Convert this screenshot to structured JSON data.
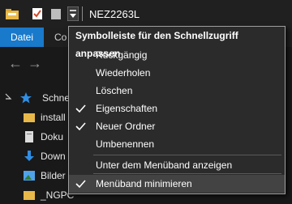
{
  "window": {
    "title": "NEZ2263L"
  },
  "ribbon": {
    "file_tab": "Datei",
    "next_tab_partial": "Co"
  },
  "tree": {
    "quick_access": "Schnell",
    "items": [
      {
        "label": "install",
        "icon": "folder-icon"
      },
      {
        "label": "Doku",
        "icon": "documents-icon"
      },
      {
        "label": "Down",
        "icon": "downloads-icon"
      },
      {
        "label": "Bilder",
        "icon": "pictures-icon"
      },
      {
        "label": "_NGPC",
        "icon": "folder-icon"
      }
    ]
  },
  "menu": {
    "header": "Symbolleiste für den Schnellzugriff anpassen",
    "items": [
      {
        "label": "Rückgängig",
        "checked": false
      },
      {
        "label": "Wiederholen",
        "checked": false
      },
      {
        "label": "Löschen",
        "checked": false
      },
      {
        "label": "Eigenschaften",
        "checked": true
      },
      {
        "label": "Neuer Ordner",
        "checked": true
      },
      {
        "label": "Umbenennen",
        "checked": false
      },
      {
        "label": "Unter dem Menüband anzeigen",
        "checked": false
      },
      {
        "label": "Menüband minimieren",
        "checked": true,
        "highlighted": true
      }
    ]
  },
  "colors": {
    "accent": "#1979ca",
    "menu_bg": "#2b2b2b",
    "highlight": "#434343",
    "folder": "#e8b84a"
  }
}
